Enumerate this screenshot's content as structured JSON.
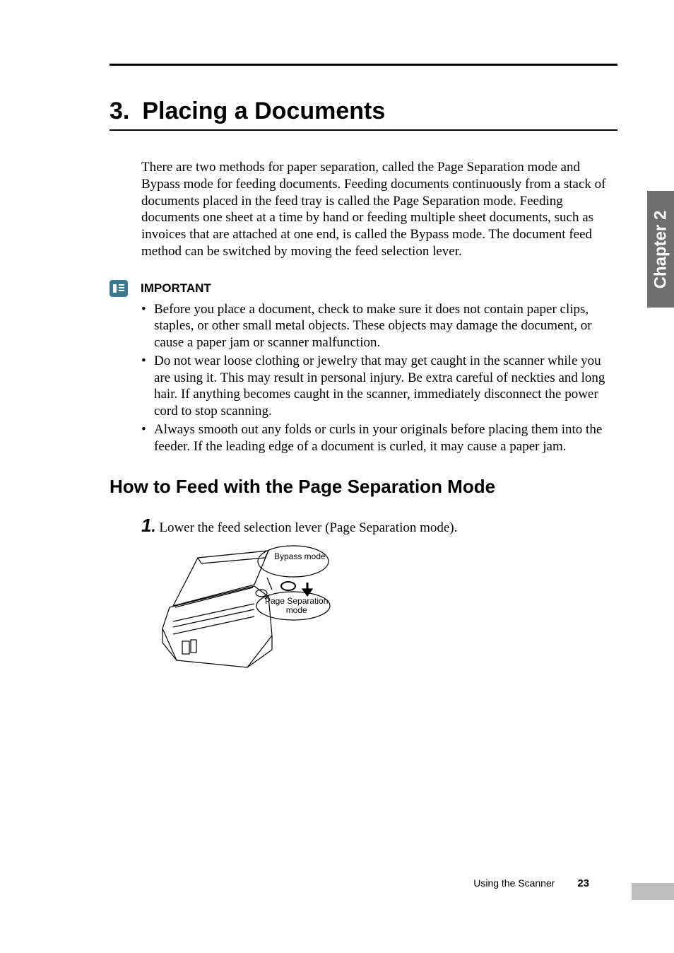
{
  "side_tab": "Chapter 2",
  "section": {
    "number": "3.",
    "title": "Placing a Documents"
  },
  "intro": "There are two methods for paper separation, called the Page Separation mode and Bypass mode for feeding documents. Feeding documents continuously from a stack of documents placed in the feed tray is called the Page Separation mode. Feeding documents one sheet at a time by hand or feeding multiple sheet documents, such as invoices that are attached at one end, is called the Bypass mode. The document feed method can be switched by moving the feed selection lever.",
  "important": {
    "label": "IMPORTANT",
    "items": [
      "Before you place a document, check to make sure it does not contain paper clips, staples, or other small metal objects. These objects may damage the document, or cause a paper jam or scanner malfunction.",
      "Do not wear loose clothing or jewelry that may get caught in the scanner while you are using it. This may result in personal injury. Be extra careful of neckties and long hair. If anything becomes caught in the scanner, immediately disconnect the power cord to stop scanning.",
      "Always smooth out any folds or curls in your originals before placing them into the feeder. If the leading edge of a document is curled, it may cause a paper jam."
    ]
  },
  "subheading": "How to Feed with the Page Separation Mode",
  "step1": {
    "num": "1",
    "dot": ".",
    "text": " Lower the feed selection lever (Page Separation mode)."
  },
  "figure": {
    "label_bypass": "Bypass mode",
    "label_page_sep_1": "Page Separation",
    "label_page_sep_2": "mode"
  },
  "footer": {
    "section": "Using the Scanner",
    "page": "23"
  }
}
